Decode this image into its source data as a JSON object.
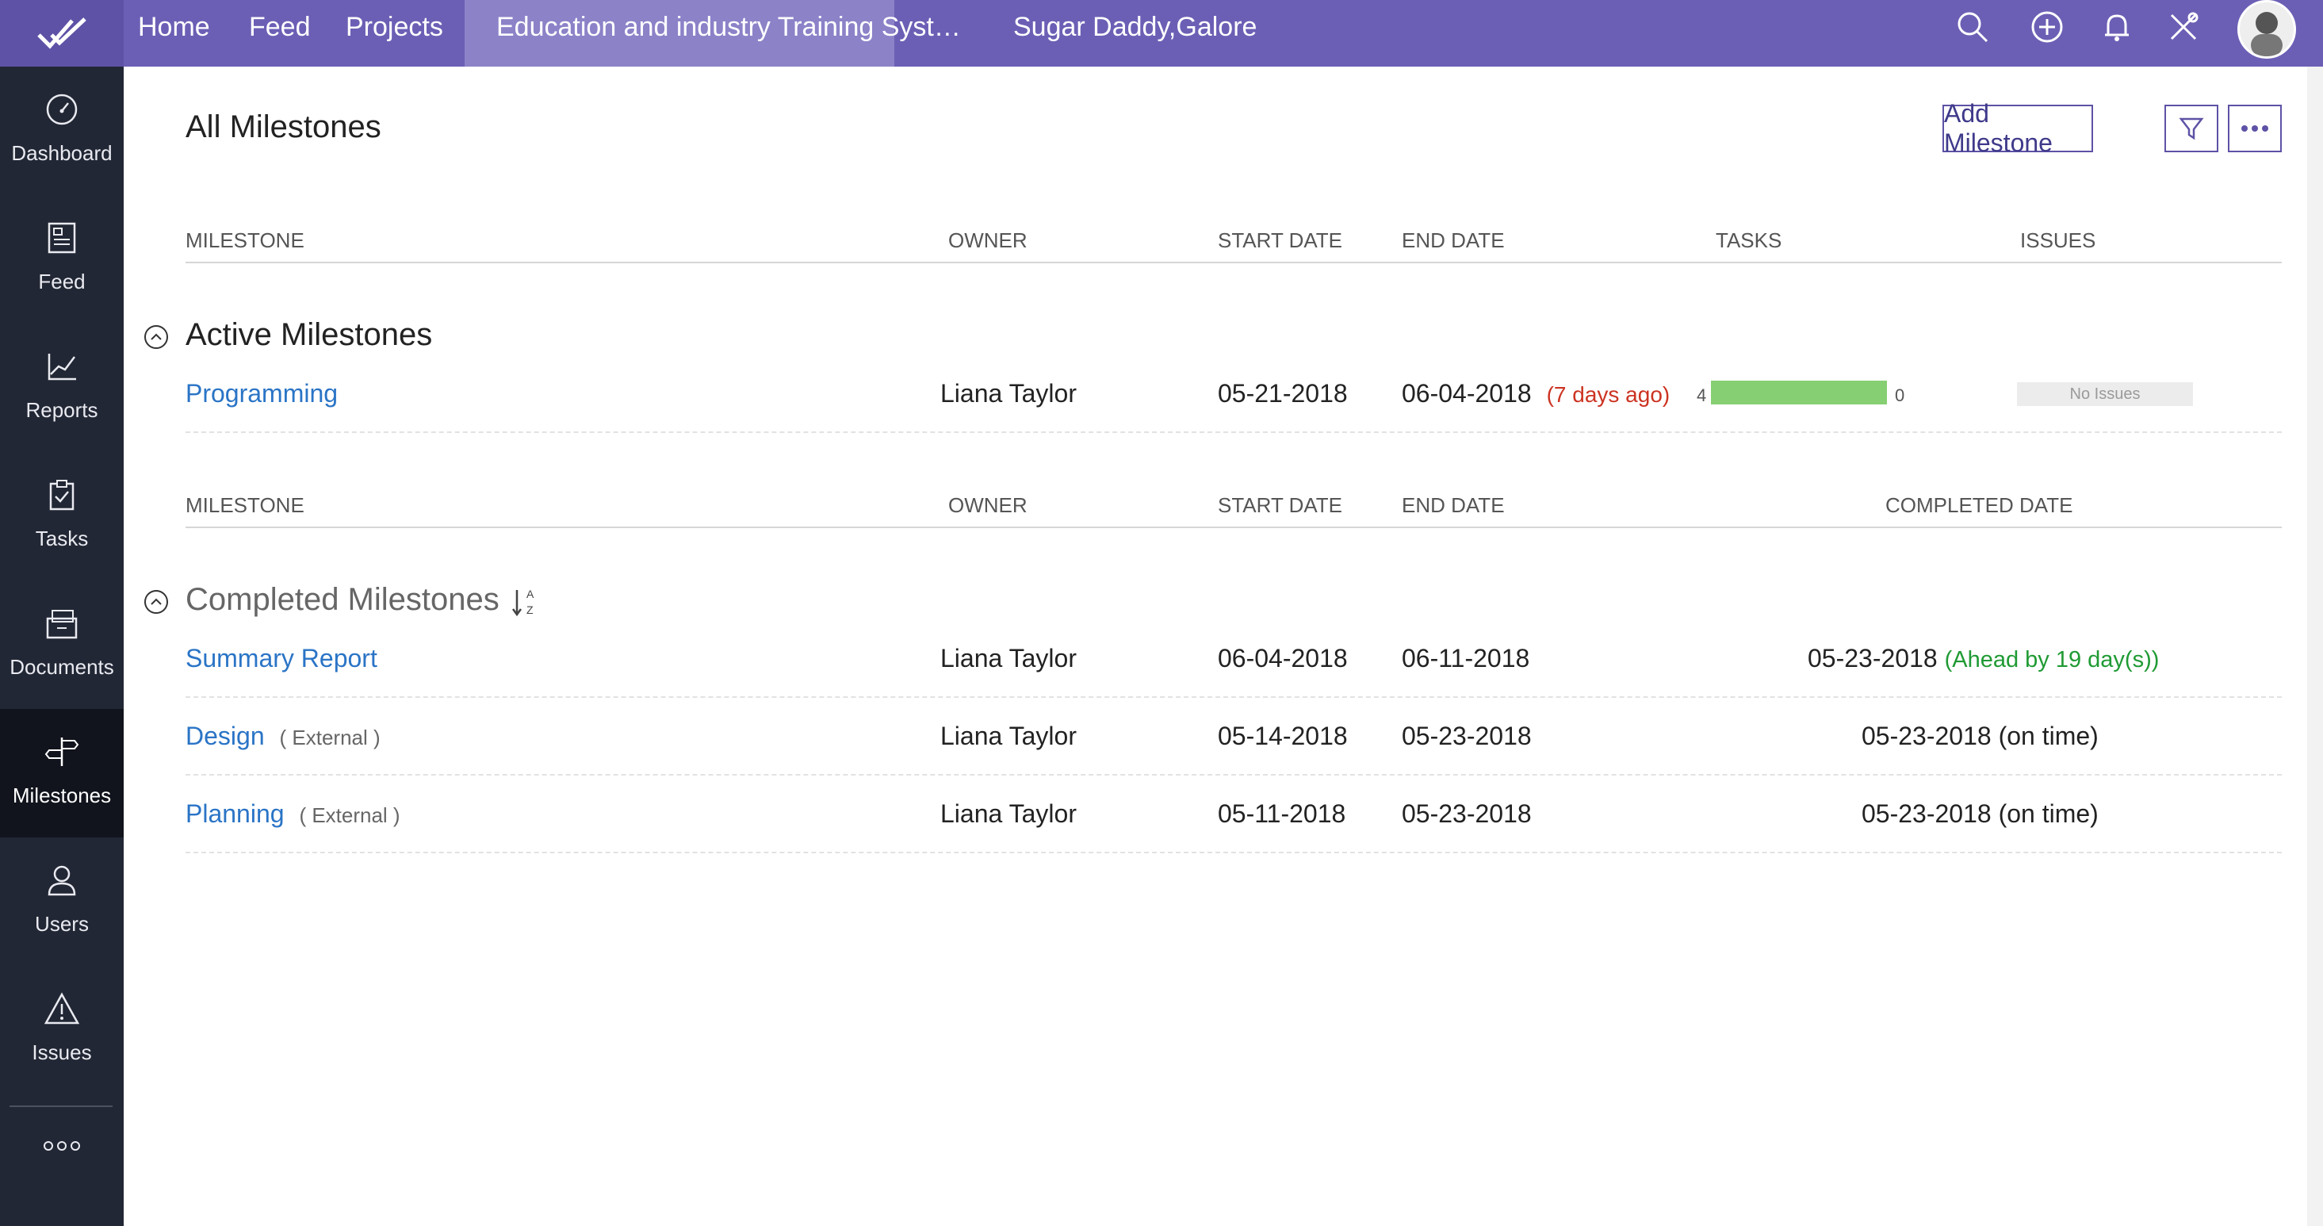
{
  "topbar": {
    "nav": [
      "Home",
      "Feed",
      "Projects"
    ],
    "active_project": "Education and industry Training Syst…",
    "secondary": "Sugar Daddy,Galore",
    "icons": [
      "search-icon",
      "plus-circle-icon",
      "bell-icon",
      "tools-icon"
    ]
  },
  "sidebar": {
    "items": [
      {
        "label": "Dashboard",
        "icon": "dashboard-icon"
      },
      {
        "label": "Feed",
        "icon": "feed-icon"
      },
      {
        "label": "Reports",
        "icon": "reports-icon"
      },
      {
        "label": "Tasks",
        "icon": "tasks-icon"
      },
      {
        "label": "Documents",
        "icon": "documents-icon"
      },
      {
        "label": "Milestones",
        "icon": "milestones-icon",
        "active": true
      },
      {
        "label": "Users",
        "icon": "users-icon"
      },
      {
        "label": "Issues",
        "icon": "issues-icon"
      }
    ]
  },
  "page": {
    "title": "All Milestones",
    "add_button": "Add Milestone"
  },
  "active_table": {
    "headers": [
      "MILESTONE",
      "OWNER",
      "START DATE",
      "END DATE",
      "TASKS",
      "ISSUES"
    ],
    "section_title": "Active Milestones",
    "rows": [
      {
        "milestone": "Programming",
        "owner": "Liana Taylor",
        "start": "05-21-2018",
        "end": "06-04-2018",
        "end_note": "(7 days ago)",
        "tasks_open": "4",
        "tasks_closed": "0",
        "tasks_progress": 1.0,
        "issues": "No Issues"
      }
    ]
  },
  "completed_table": {
    "headers": [
      "MILESTONE",
      "OWNER",
      "START DATE",
      "END DATE",
      "COMPLETED DATE"
    ],
    "section_title": "Completed Milestones",
    "rows": [
      {
        "milestone": "Summary Report",
        "external": "",
        "owner": "Liana Taylor",
        "start": "06-04-2018",
        "end": "06-11-2018",
        "completed": "05-23-2018",
        "completed_note": "(Ahead by 19 day(s))"
      },
      {
        "milestone": "Design",
        "external": "( External )",
        "owner": "Liana Taylor",
        "start": "05-14-2018",
        "end": "05-23-2018",
        "completed": "05-23-2018",
        "completed_note": "(on time)"
      },
      {
        "milestone": "Planning",
        "external": "( External )",
        "owner": "Liana Taylor",
        "start": "05-11-2018",
        "end": "05-23-2018",
        "completed": "05-23-2018",
        "completed_note": "(on time)"
      }
    ]
  },
  "colors": {
    "topbar": "#6b5fb5",
    "sidebar": "#222735",
    "link": "#2a74c6",
    "overdue": "#cc3322",
    "ahead": "#1f9a33",
    "task_bar": "#86cf73"
  }
}
